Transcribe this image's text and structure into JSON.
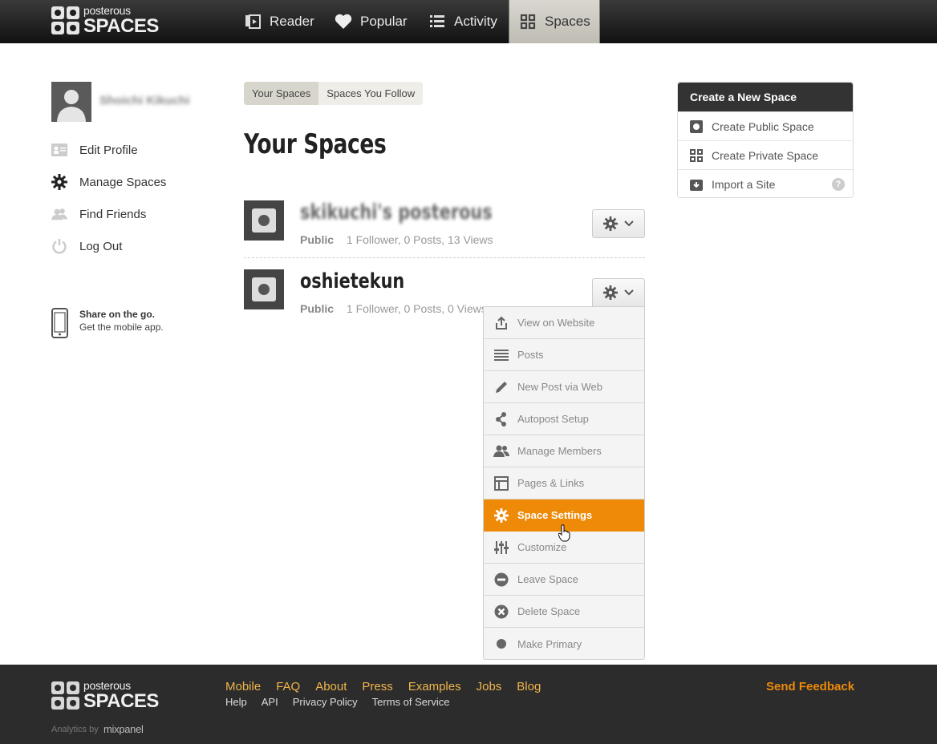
{
  "brand": {
    "logo_small": "posterous",
    "logo_big": "SPACES"
  },
  "topnav": {
    "items": [
      {
        "label": "Reader",
        "icon": "reader-icon"
      },
      {
        "label": "Popular",
        "icon": "heart-icon"
      },
      {
        "label": "Activity",
        "icon": "list-icon"
      },
      {
        "label": "Spaces",
        "icon": "grid-icon",
        "active": true
      }
    ]
  },
  "sidebar": {
    "user_name": "Shoichi Kikuchi",
    "items": [
      {
        "label": "Edit Profile",
        "icon": "id-card-icon"
      },
      {
        "label": "Manage Spaces",
        "icon": "gear-icon"
      },
      {
        "label": "Find Friends",
        "icon": "friends-icon"
      },
      {
        "label": "Log Out",
        "icon": "power-icon"
      }
    ],
    "mobile": {
      "title": "Share on the go.",
      "subtitle": "Get the mobile app."
    }
  },
  "tabs": {
    "your_spaces": "Your Spaces",
    "spaces_you_follow": "Spaces You Follow"
  },
  "page_title": "Your Spaces",
  "spaces": [
    {
      "name": "skikuchi's posterous",
      "visibility": "Public",
      "followers": "1 Follower,",
      "posts": "0 Posts,",
      "views": "13 Views"
    },
    {
      "name": "oshietekun",
      "visibility": "Public",
      "followers": "1 Follower,",
      "posts": "0 Posts,",
      "views": "0 Views"
    }
  ],
  "dropdown": {
    "items": [
      {
        "label": "View on Website",
        "icon": "share-icon"
      },
      {
        "label": "Posts",
        "icon": "lines-icon"
      },
      {
        "label": "New Post via Web",
        "icon": "pencil-icon"
      },
      {
        "label": "Autopost Setup",
        "icon": "autopost-icon"
      },
      {
        "label": "Manage Members",
        "icon": "members-icon"
      },
      {
        "label": "Pages & Links",
        "icon": "pages-icon"
      },
      {
        "label": "Space Settings",
        "icon": "gear-icon",
        "highlighted": true
      },
      {
        "label": "Customize",
        "icon": "sliders-icon"
      },
      {
        "label": "Leave Space",
        "icon": "minus-circle-icon"
      },
      {
        "label": "Delete Space",
        "icon": "x-circle-icon"
      },
      {
        "label": "Make Primary",
        "icon": "dot-icon"
      }
    ]
  },
  "create_panel": {
    "title": "Create a New Space",
    "items": [
      {
        "label": "Create Public Space",
        "icon": "public-space-icon"
      },
      {
        "label": "Create Private Space",
        "icon": "private-space-icon"
      },
      {
        "label": "Import a Site",
        "icon": "import-icon",
        "help": "?"
      }
    ]
  },
  "footer": {
    "links_row1": [
      "Mobile",
      "FAQ",
      "About",
      "Press",
      "Examples",
      "Jobs",
      "Blog"
    ],
    "links_row2": [
      "Help",
      "API",
      "Privacy Policy",
      "Terms of Service"
    ],
    "send_feedback": "Send Feedback",
    "analytics_by": "Analytics by",
    "mixpanel": "mixpanel"
  },
  "colors": {
    "accent": "#ee8a08",
    "footer_link": "#f0b54b",
    "topbar": "#1a1a1a"
  }
}
